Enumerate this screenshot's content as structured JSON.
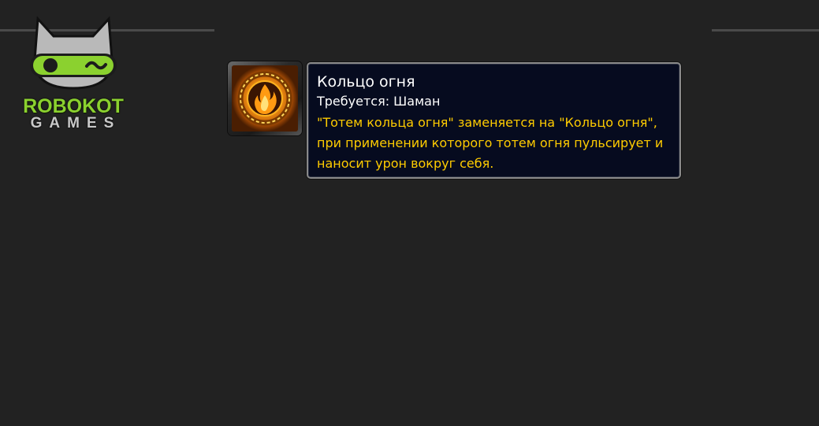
{
  "logo": {
    "line1": "ROBOKOT",
    "line2": "GAMES",
    "icon": "robot-cat-icon",
    "accent": "#8bd12f"
  },
  "spell": {
    "icon": "fire-ring-icon"
  },
  "tooltip": {
    "title": "Кольцо огня",
    "requirement": "Требуется: Шаман",
    "description": "\"Тотем кольца огня\" заменяется на \"Кольцо огня\", при применении которого тотем огня пульсирует и наносит урон вокруг себя.",
    "title_color": "#ffffff",
    "description_color": "#ffcc00"
  }
}
